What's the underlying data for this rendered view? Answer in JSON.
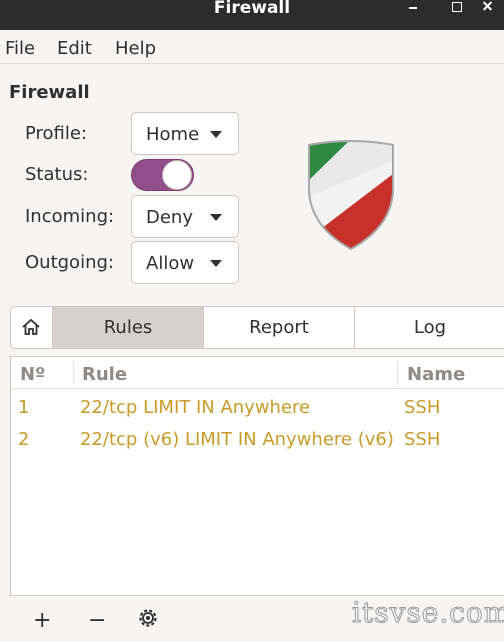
{
  "window": {
    "title": "Firewall"
  },
  "menu": {
    "file": "File",
    "edit": "Edit",
    "help": "Help"
  },
  "firewall": {
    "section_title": "Firewall",
    "profile_label": "Profile:",
    "profile_value": "Home",
    "status_label": "Status:",
    "status_on": true,
    "incoming_label": "Incoming:",
    "incoming_value": "Deny",
    "outgoing_label": "Outgoing:",
    "outgoing_value": "Allow"
  },
  "tabs": {
    "rules": "Rules",
    "report": "Report",
    "log": "Log"
  },
  "rules_table": {
    "columns": {
      "num": "Nº",
      "rule": "Rule",
      "name": "Name"
    },
    "rows": [
      {
        "num": "1",
        "rule": "22/tcp LIMIT IN Anywhere",
        "name": "SSH"
      },
      {
        "num": "2",
        "rule": "22/tcp (v6) LIMIT IN Anywhere (v6)",
        "name": "SSH"
      }
    ]
  },
  "toolbar": {
    "add": "+",
    "remove": "−"
  },
  "watermark": "itsvse.com",
  "colors": {
    "toggle_on": "#924d8b",
    "rule_text": "#c99b2a",
    "titlebar": "#2c2c2c"
  }
}
